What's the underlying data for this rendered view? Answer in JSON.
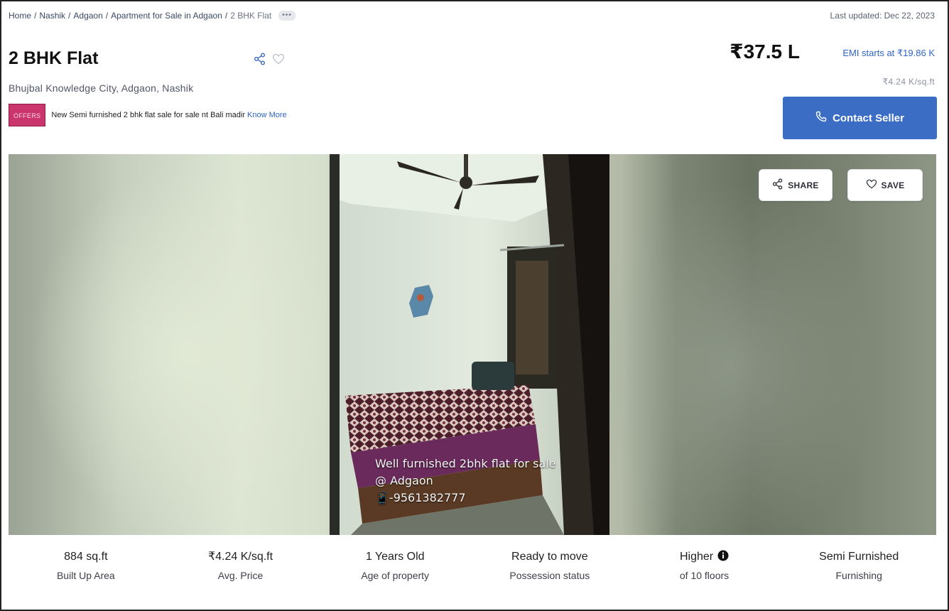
{
  "breadcrumb": {
    "items": [
      "Home",
      "Nashik",
      "Adgaon",
      "Apartment for Sale in Adgaon"
    ],
    "current": "2 BHK Flat",
    "separator": "/",
    "more": "•••"
  },
  "last_updated": "Last updated: Dec 22, 2023",
  "listing": {
    "title": "2 BHK Flat",
    "address": "Bhujbal Knowledge City, Adgaon, Nashik",
    "price": "₹37.5 L",
    "emi": "EMI starts at ₹19.86 K",
    "price_per_sqft": "₹4.24 K/sq.ft"
  },
  "offer": {
    "badge": "OFFERS",
    "text": "New Semi furnished 2 bhk flat sale for sale nt Bali madir",
    "link": "Know More"
  },
  "contact_button": {
    "label": "Contact Seller"
  },
  "gallery": {
    "caption_lines": [
      "Well furnished 2bhk flat for sale",
      "@ Adgaon",
      "-9561382777"
    ],
    "share_label": "SHARE",
    "save_label": "SAVE"
  },
  "summary": [
    {
      "value": "884 sq.ft",
      "label": "Built Up Area"
    },
    {
      "value": "₹4.24 K/sq.ft",
      "label": "Avg. Price"
    },
    {
      "value": "1 Years Old",
      "label": "Age of property"
    },
    {
      "value": "Ready to move",
      "label": "Possession status"
    },
    {
      "value": "Higher",
      "label": "of 10 floors"
    },
    {
      "value": "Semi Furnished",
      "label": "Furnishing"
    }
  ],
  "colors": {
    "accent_blue": "#3b6dc4",
    "link_blue": "#2e63c7",
    "offer_pink": "#c9356c"
  },
  "icons": {
    "title_share": "share-icon",
    "title_save": "heart-icon",
    "contact": "phone-icon",
    "floor_info": "info-icon"
  }
}
